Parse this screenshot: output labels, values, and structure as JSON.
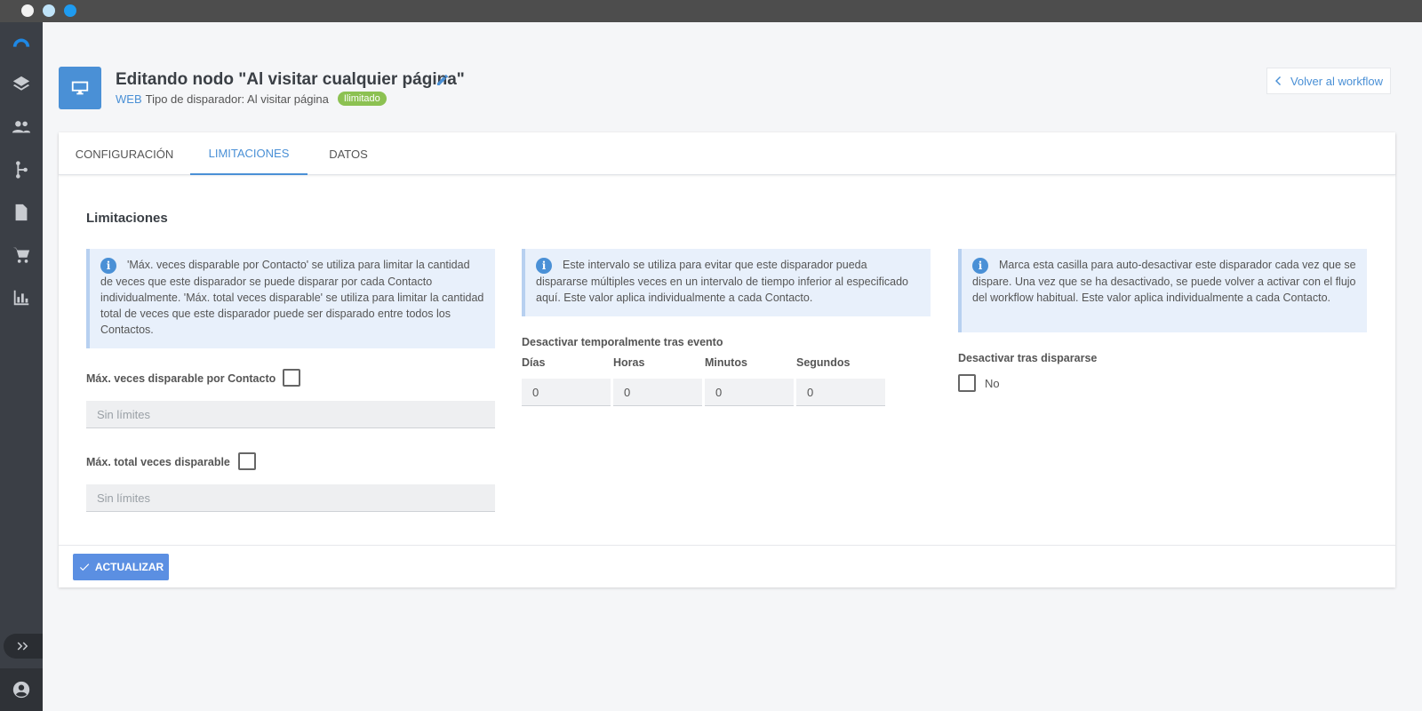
{
  "header": {
    "title": "Editando nodo \"Al visitar cualquier página\"",
    "category": "WEB",
    "trigger_type": "Tipo de disparador: Al visitar página",
    "badge": "Ilimitado",
    "back_label": "Volver al workflow"
  },
  "tabs": [
    {
      "label": "CONFIGURACIÓN"
    },
    {
      "label": "LIMITACIONES"
    },
    {
      "label": "DATOS"
    }
  ],
  "section_title": "Limitaciones",
  "col1": {
    "info": "'Máx. veces disparable por Contacto' se utiliza para limitar la cantidad de veces que este disparador se puede disparar por cada Contacto individualmente. 'Máx. total veces disparable' se utiliza para limitar la cantidad total de veces que este disparador puede ser disparado entre todos los Contactos.",
    "max_per_contact_label": "Máx. veces disparable por Contacto",
    "max_per_contact_placeholder": "Sin límites",
    "max_total_label": "Máx. total veces disparable",
    "max_total_placeholder": "Sin límites"
  },
  "col2": {
    "info": "Este intervalo se utiliza para evitar que este disparador pueda dispararse múltiples veces en un intervalo de tiempo inferior al especificado aquí. Este valor aplica individualmente a cada Contacto.",
    "group_label": "Desactivar temporalmente tras evento",
    "days_label": "Días",
    "days_value": "0",
    "hours_label": "Horas",
    "hours_value": "0",
    "minutes_label": "Minutos",
    "minutes_value": "0",
    "seconds_label": "Segundos",
    "seconds_value": "0"
  },
  "col3": {
    "info": "Marca esta casilla para auto-desactivar este disparador cada vez que se dispare. Una vez que se ha desactivado, se puede volver a activar con el flujo del workflow habitual. Este valor aplica individualmente a cada Contacto.",
    "deactivate_label": "Desactivar tras dispararse",
    "deactivate_value": "No"
  },
  "footer": {
    "update_label": "ACTUALIZAR"
  },
  "colors": {
    "accent": "#4a90d6",
    "badge": "#8cc152",
    "sidebar": "#3b3f46"
  }
}
